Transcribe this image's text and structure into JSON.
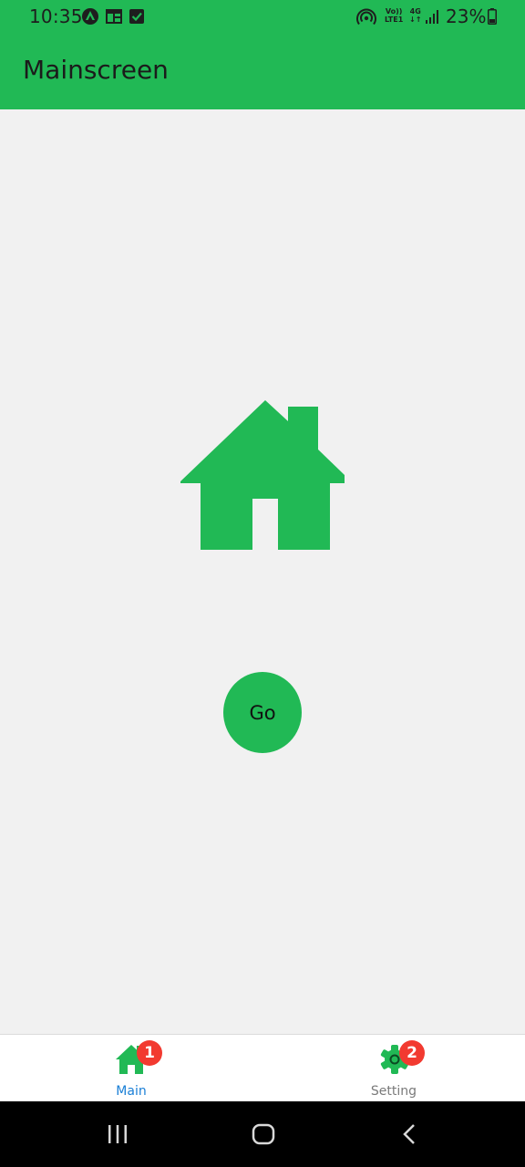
{
  "status_bar": {
    "time": "10:35",
    "network_top": "Vo))",
    "network_bottom": "LTE1",
    "network_gen": "4G",
    "battery": "23%",
    "icons": [
      "nearby-share-icon",
      "news-icon",
      "check-icon",
      "hotspot-icon",
      "signal-icon",
      "battery-icon"
    ]
  },
  "app_bar": {
    "title": "Mainscreen"
  },
  "content": {
    "illustration": "home-icon",
    "go_button_label": "Go"
  },
  "bottom_nav": {
    "items": [
      {
        "label": "Main",
        "icon": "home-icon",
        "badge": "1",
        "active": true
      },
      {
        "label": "Setting",
        "icon": "gear-icon",
        "badge": "2",
        "active": false
      }
    ]
  },
  "system_nav": {
    "buttons": [
      "recents-icon",
      "home-button-icon",
      "back-icon"
    ]
  },
  "colors": {
    "accent": "#21b955",
    "background": "#f1f1f1",
    "badge": "#f23a30",
    "active_label": "#1a7fd6",
    "inactive_label": "#7a7a7a"
  }
}
